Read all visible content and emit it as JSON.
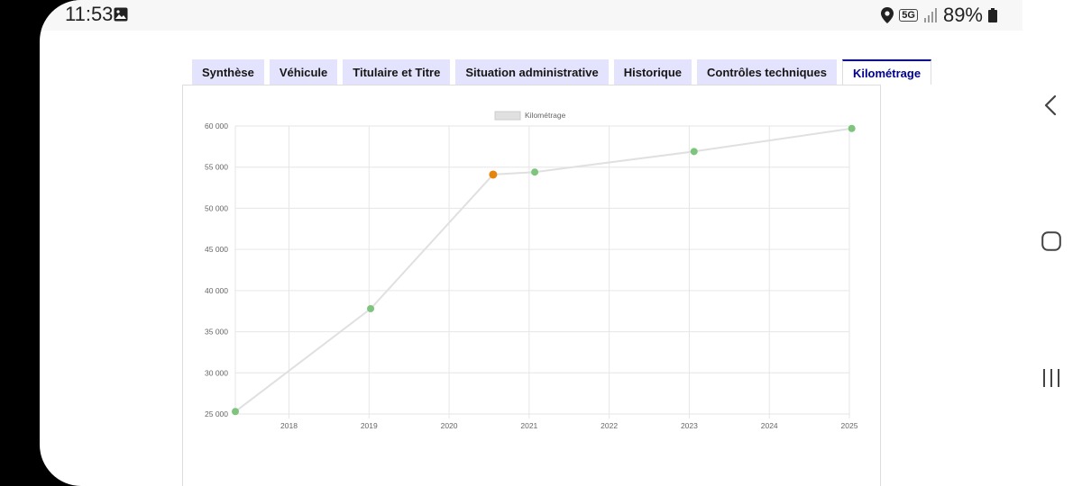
{
  "status_bar": {
    "time": "11:53",
    "network": "5G",
    "battery": "89%"
  },
  "tabs": [
    {
      "label": "Synthèse"
    },
    {
      "label": "Véhicule"
    },
    {
      "label": "Titulaire et Titre"
    },
    {
      "label": "Situation administrative"
    },
    {
      "label": "Historique"
    },
    {
      "label": "Contrôles techniques"
    },
    {
      "label": "Kilométrage",
      "active": true
    }
  ],
  "colors": {
    "tab_bg": "#e3e3fd",
    "tab_active_text": "#000091",
    "line": "#e0e0e0",
    "point_normal": "#7dc47d",
    "point_highlight": "#e6850e"
  },
  "chart_data": {
    "type": "line",
    "title": "",
    "xlabel": "",
    "ylabel": "",
    "x_ticks": [
      "2018",
      "2019",
      "2020",
      "2021",
      "2022",
      "2023",
      "2024",
      "2025"
    ],
    "y_ticks": [
      "25 000",
      "30 000",
      "35 000",
      "40 000",
      "45 000",
      "50 000",
      "55 000",
      "60 000"
    ],
    "xlim": [
      2017.33,
      2025.0
    ],
    "ylim": [
      25000,
      60000
    ],
    "grid": true,
    "legend": "top-center",
    "series": [
      {
        "name": "Kilométrage",
        "points": [
          {
            "x": 2017.33,
            "y": 25300,
            "highlight": false
          },
          {
            "x": 2019.02,
            "y": 37800,
            "highlight": false
          },
          {
            "x": 2020.55,
            "y": 54100,
            "highlight": true
          },
          {
            "x": 2021.07,
            "y": 54400,
            "highlight": false
          },
          {
            "x": 2023.06,
            "y": 56900,
            "highlight": false
          },
          {
            "x": 2025.03,
            "y": 59700,
            "highlight": false
          }
        ]
      }
    ]
  }
}
